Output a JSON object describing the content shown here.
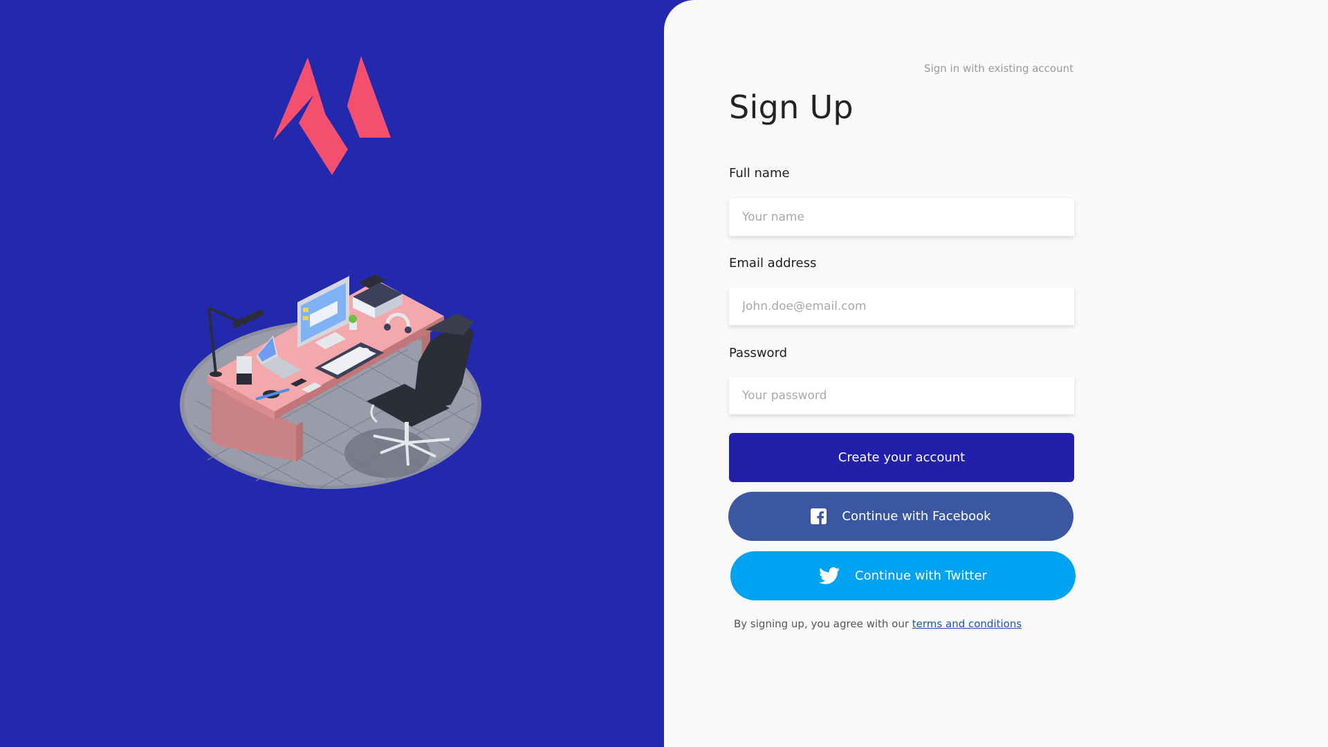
{
  "auth": {
    "signin_link": "Sign in with existing account",
    "title": "Sign Up",
    "fields": {
      "fullname": {
        "label": "Full name",
        "placeholder": "Your name",
        "value": ""
      },
      "email": {
        "label": "Email address",
        "placeholder": "John.doe@email.com",
        "value": ""
      },
      "password": {
        "label": "Password",
        "placeholder": "Your password",
        "value": ""
      }
    },
    "buttons": {
      "create": "Create your account",
      "facebook": "Continue with Facebook",
      "twitter": "Continue with Twitter"
    },
    "terms_prefix": "By signing up, you agree with our ",
    "terms_link": "terms and conditions"
  },
  "icons": {
    "logo": "brand-logo-icon",
    "facebook": "facebook-icon",
    "twitter": "twitter-icon"
  },
  "colors": {
    "hero_background": "#2329ad",
    "panel_background": "#f9f9f9",
    "logo": "#f54f6f",
    "create_button": "#2220ab",
    "facebook_button": "#3c57a2",
    "twitter_button": "#00a2f2",
    "terms_link": "#1a57a8"
  }
}
